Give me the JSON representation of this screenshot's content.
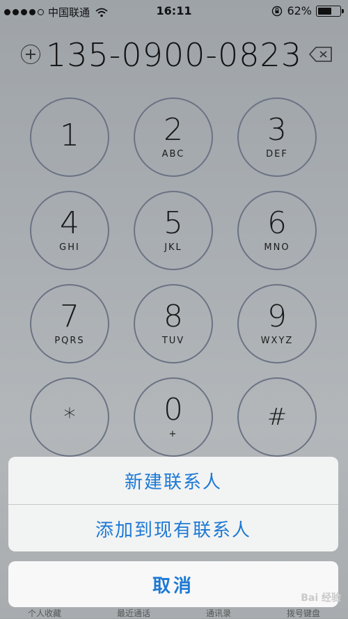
{
  "status": {
    "carrier": "中国联通",
    "time": "16:11",
    "battery": "62%",
    "battery_level": 0.62,
    "signal_filled": 4,
    "signal_total": 5
  },
  "dialer": {
    "number": "135-0900-0823"
  },
  "keys": [
    {
      "digit": "1",
      "letters": ""
    },
    {
      "digit": "2",
      "letters": "ABC"
    },
    {
      "digit": "3",
      "letters": "DEF"
    },
    {
      "digit": "4",
      "letters": "GHI"
    },
    {
      "digit": "5",
      "letters": "JKL"
    },
    {
      "digit": "6",
      "letters": "MNO"
    },
    {
      "digit": "7",
      "letters": "PQRS"
    },
    {
      "digit": "8",
      "letters": "TUV"
    },
    {
      "digit": "9",
      "letters": "WXYZ"
    },
    {
      "digit": "*",
      "letters": ""
    },
    {
      "digit": "0",
      "letters": "+"
    },
    {
      "digit": "#",
      "letters": ""
    }
  ],
  "sheet": {
    "new_contact": "新建联系人",
    "add_existing": "添加到现有联系人",
    "cancel": "取消"
  },
  "tabs": [
    "个人收藏",
    "最近通话",
    "通讯录",
    "拨号键盘"
  ],
  "watermark": "Bai 经验",
  "colors": {
    "accent": "#1c79d4",
    "key_ring": "#6b7384"
  }
}
